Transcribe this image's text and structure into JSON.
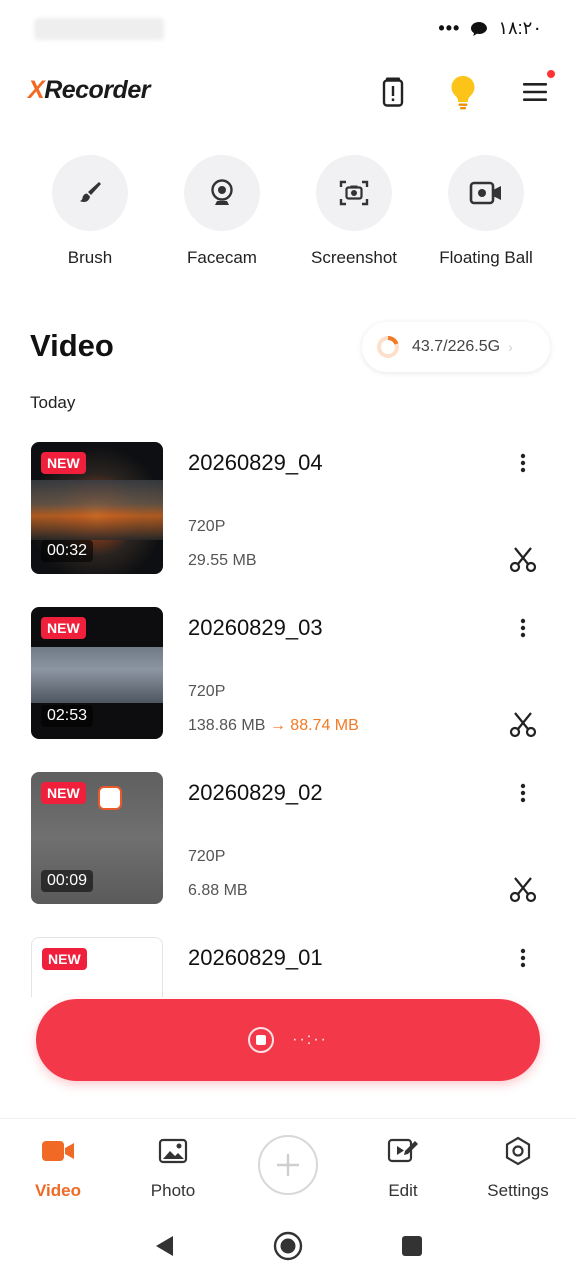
{
  "status_bar": {
    "time": "۱۸:۲۰",
    "dots": "•••"
  },
  "header": {
    "logo_x": "X",
    "logo_rest": "Recorder",
    "icons": [
      "battery-alert-icon",
      "bulb-icon",
      "menu-icon"
    ],
    "menu_notification": true
  },
  "tools": [
    {
      "label": "Brush",
      "icon": "brush-icon"
    },
    {
      "label": "Facecam",
      "icon": "webcam-icon"
    },
    {
      "label": "Screenshot",
      "icon": "screenshot-camera-icon"
    },
    {
      "label": "Floating Ball",
      "icon": "video-camera-icon"
    }
  ],
  "video_section": {
    "title": "Video",
    "storage": "43.7/226.5G",
    "date_group": "Today"
  },
  "videos": [
    {
      "name": "20260829_04",
      "resolution": "720P",
      "size": "29.55 MB",
      "duration": "00:32",
      "badge": "NEW"
    },
    {
      "name": "20260829_03",
      "resolution": "720P",
      "size": "138.86 MB",
      "size_arrow": "→",
      "compressed_size": "88.74 MB",
      "duration": "02:53",
      "badge": "NEW"
    },
    {
      "name": "20260829_02",
      "resolution": "720P",
      "size": "6.88 MB",
      "duration": "00:09",
      "badge": "NEW"
    },
    {
      "name": "20260829_01",
      "badge": "NEW"
    }
  ],
  "record_bar": {
    "timer": "··:··"
  },
  "bottom_nav": {
    "items": [
      {
        "label": "Video",
        "icon": "video-icon",
        "active": true
      },
      {
        "label": "Photo",
        "icon": "photo-icon",
        "active": false
      },
      {
        "label": "Edit",
        "icon": "edit-video-icon",
        "active": false
      },
      {
        "label": "Settings",
        "icon": "settings-hex-icon",
        "active": false
      }
    ]
  },
  "colors": {
    "accent": "#f06a25",
    "record": "#f3384a",
    "badge": "#f0203c",
    "compressed": "#f37a24"
  }
}
